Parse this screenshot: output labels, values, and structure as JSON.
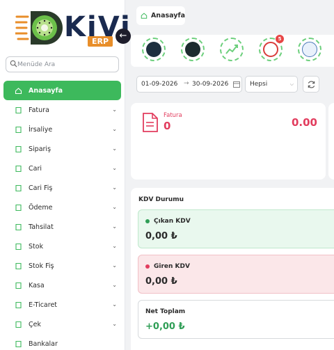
{
  "brand": {
    "name": "KiVi",
    "suffix": "ERP",
    "accent": "#3db95c",
    "logo_orange": "#e88e2a"
  },
  "search": {
    "placeholder": "Menüde Ara"
  },
  "menu": [
    {
      "label": "Anasayfa",
      "icon": "home-icon",
      "active": true,
      "expandable": false
    },
    {
      "label": "Fatura",
      "icon": "invoice-icon",
      "expandable": true
    },
    {
      "label": "İrsaliye",
      "icon": "waybill-icon",
      "expandable": true
    },
    {
      "label": "Sipariş",
      "icon": "order-icon",
      "expandable": true
    },
    {
      "label": "Cari",
      "icon": "account-icon",
      "expandable": true
    },
    {
      "label": "Cari Fiş",
      "icon": "receipt-icon",
      "expandable": true
    },
    {
      "label": "Ödeme",
      "icon": "payment-icon",
      "expandable": true
    },
    {
      "label": "Tahsilat",
      "icon": "collection-icon",
      "expandable": true
    },
    {
      "label": "Stok",
      "icon": "stock-icon",
      "expandable": true
    },
    {
      "label": "Stok Fiş",
      "icon": "stock-receipt-icon",
      "expandable": true
    },
    {
      "label": "Kasa",
      "icon": "cash-icon",
      "expandable": true
    },
    {
      "label": "E-Ticaret",
      "icon": "ecommerce-icon",
      "expandable": true
    },
    {
      "label": "Çek",
      "icon": "cheque-icon",
      "expandable": true
    },
    {
      "label": "Bankalar",
      "icon": "bank-icon",
      "expandable": false
    }
  ],
  "breadcrumb": {
    "label": "Anasayfa"
  },
  "quick_links": [
    {
      "icon": "gib-icon",
      "badge": ""
    },
    {
      "icon": "ilk500-icon",
      "badge": ""
    },
    {
      "icon": "growth-chart-icon",
      "badge": ""
    },
    {
      "icon": "tax-office-icon",
      "badge": "5"
    },
    {
      "icon": "sgk-icon",
      "badge": ""
    }
  ],
  "filters": {
    "date_start": "01-09-2026",
    "date_end": "30-09-2026",
    "arrow": "→",
    "type_selected": "Hepsi"
  },
  "summary_card": {
    "label": "Fatura",
    "count": "0",
    "total": "0.00"
  },
  "kdv": {
    "title": "KDV Durumu",
    "outgoing": {
      "label": "Çıkan KDV",
      "amount": "0,00 ₺"
    },
    "incoming": {
      "label": "Giren KDV",
      "amount": "0,00 ₺"
    },
    "net": {
      "label": "Net Toplam",
      "amount": "+0,00 ₺"
    }
  }
}
